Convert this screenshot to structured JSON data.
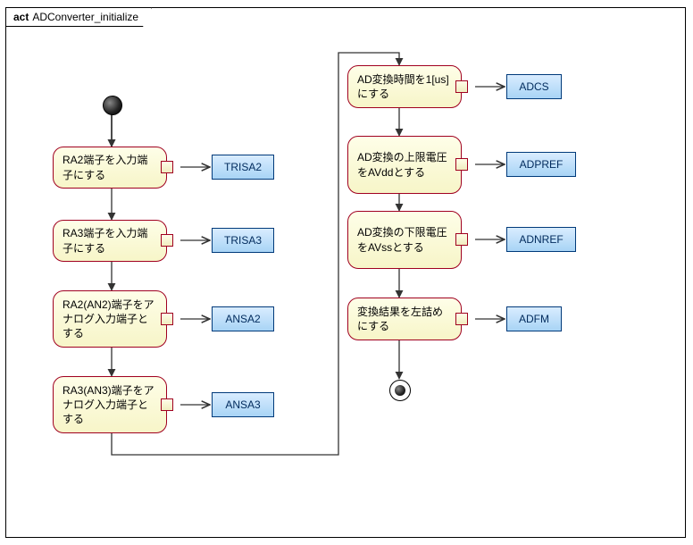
{
  "frame": {
    "keyword": "act",
    "name": "ADConverter_initialize"
  },
  "activities": {
    "a1": "RA2端子を入力端子にする",
    "a2": "RA3端子を入力端子にする",
    "a3": "RA2(AN2)端子をアナログ入力端子とする",
    "a4": "RA3(AN3)端子をアナログ入力端子とする",
    "a5": "AD変換時間を1[us]にする",
    "a6": "AD変換の上限電圧をAVddとする",
    "a7": "AD変換の下限電圧をAVssとする",
    "a8": "変換結果を左詰めにする"
  },
  "datastores": {
    "d1": "TRISA2",
    "d2": "TRISA3",
    "d3": "ANSA2",
    "d4": "ANSA3",
    "d5": "ADCS",
    "d6": "ADPREF",
    "d7": "ADNREF",
    "d8": "ADFM"
  }
}
